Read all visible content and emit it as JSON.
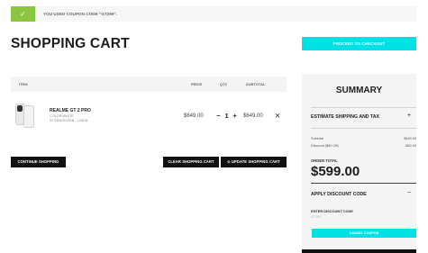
{
  "notice": {
    "check": "✓",
    "text": "YOU USED COUPON CODE \"GT269\"."
  },
  "page": {
    "title": "SHOPPING CART"
  },
  "actions": {
    "proceed": "PROCEED TO CHECKOUT",
    "continue": "CONTINUE SHOPPING",
    "clear": "CLEAR SHOPPING CART",
    "update": "UPDATE SHOPPING CART",
    "update_icon": "⊙"
  },
  "table": {
    "headers": {
      "item": "ITEM",
      "price": "PRICE",
      "qty": "QTY",
      "subtotal": "SUBTOTAL"
    }
  },
  "cart_item": {
    "name": "REALME GT 2 PRO",
    "color": "COLOR:WHITE",
    "storage": "STORAGE:8GB - 128GB",
    "price": "$649.00",
    "qty_minus": "−",
    "qty": "1",
    "qty_plus": "+",
    "subtotal": "$649.00",
    "remove": "✕"
  },
  "summary": {
    "title": "SUMMARY",
    "shipping": "ESTIMATE SHIPPING AND TAX",
    "shipping_toggle": "+",
    "subtotal_label": "Subtotal",
    "subtotal_value": "$649.00",
    "discount_label": "Discount ($50 Off)",
    "discount_value": "-$50.00",
    "order_total_label": "ORDER TOTAL",
    "order_total_value": "$599.00",
    "discount_section": "APPLY DISCOUNT CODE",
    "discount_toggle": "−",
    "enter_code_label": "ENTER DISCOUNT CODE",
    "code_value": "GT269",
    "cancel": "CANCEL COUPON"
  }
}
